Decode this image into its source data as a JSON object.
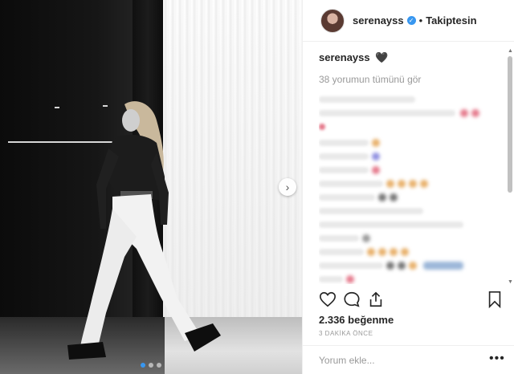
{
  "post": {
    "username": "serenayss",
    "follow_label": "Takiptesin",
    "separator": "•",
    "caption_user": "serenayss",
    "caption_text": "🖤",
    "view_all_comments": "38 yorumun tümünü gör",
    "likes": "2.336 beğenme",
    "time_ago": "3 DAKİKA ÖNCE",
    "add_comment_placeholder": "Yorum ekle...",
    "more_options": "•••"
  },
  "icons": {
    "like": "heart-outline-icon",
    "comment": "speech-bubble-icon",
    "share": "share-arrow-icon",
    "save": "bookmark-icon",
    "verified": "verified-badge-icon",
    "next": "chevron-right-icon"
  },
  "colors": {
    "accent": "#3897f0",
    "text": "#262626",
    "muted": "#999999"
  },
  "carousel": {
    "slides": 3,
    "active_index": 0
  }
}
